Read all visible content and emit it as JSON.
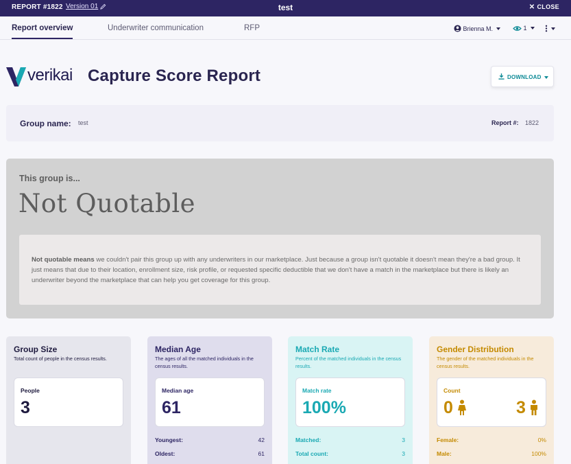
{
  "topbar": {
    "report_id": "REPORT #1822",
    "version": "Version 01",
    "title": "test",
    "close_label": "CLOSE"
  },
  "tabs": [
    {
      "label": "Report overview",
      "active": true
    },
    {
      "label": "Underwriter communication",
      "active": false
    },
    {
      "label": "RFP",
      "active": false
    }
  ],
  "toolbar": {
    "user_name": "Brienna M.",
    "viewers_count": "1"
  },
  "header": {
    "logo_text": "verikai",
    "title": "Capture Score Report",
    "download_label": "DOWNLOAD"
  },
  "group": {
    "name_label": "Group name:",
    "name_value": "test",
    "report_label": "Report #:",
    "report_value": "1822"
  },
  "status": {
    "prefix": "This group is...",
    "value": "Not Quotable",
    "note_bold": "Not quotable means",
    "note_text": " we couldn't pair this group up with any underwriters in our marketplace. Just because a group isn't quotable it doesn't mean they're a bad group. It just means that due to their location, enrollment size, risk profile, or requested specific deductible that we don't have a match in the marketplace but there is likely an underwriter beyond the marketplace that can help you get coverage for this group."
  },
  "cards": {
    "group_size": {
      "title": "Group Size",
      "subtitle": "Total count of people in the census results.",
      "label": "People",
      "value": "3"
    },
    "median_age": {
      "title": "Median Age",
      "subtitle": "The ages of all the matched individuals in the census results.",
      "label": "Median age",
      "value": "61",
      "youngest_label": "Youngest:",
      "youngest_value": "42",
      "oldest_label": "Oldest:",
      "oldest_value": "61"
    },
    "match_rate": {
      "title": "Match Rate",
      "subtitle": "Percent of the matched individuals in the census results.",
      "label": "Match rate",
      "value": "100%",
      "matched_label": "Matched:",
      "matched_value": "3",
      "total_label": "Total count:",
      "total_value": "3"
    },
    "gender": {
      "title": "Gender Distribution",
      "subtitle": "The gender of the matched individuals in the census results.",
      "label": "Count",
      "female_count": "0",
      "male_count": "3",
      "female_label": "Female:",
      "female_value": "0%",
      "male_label": "Male:",
      "male_value": "100%"
    }
  },
  "colors": {
    "brand": "#2d2563",
    "teal": "#1aa9b3",
    "gold": "#c48a00",
    "status_bg": "#d2d2d2"
  }
}
